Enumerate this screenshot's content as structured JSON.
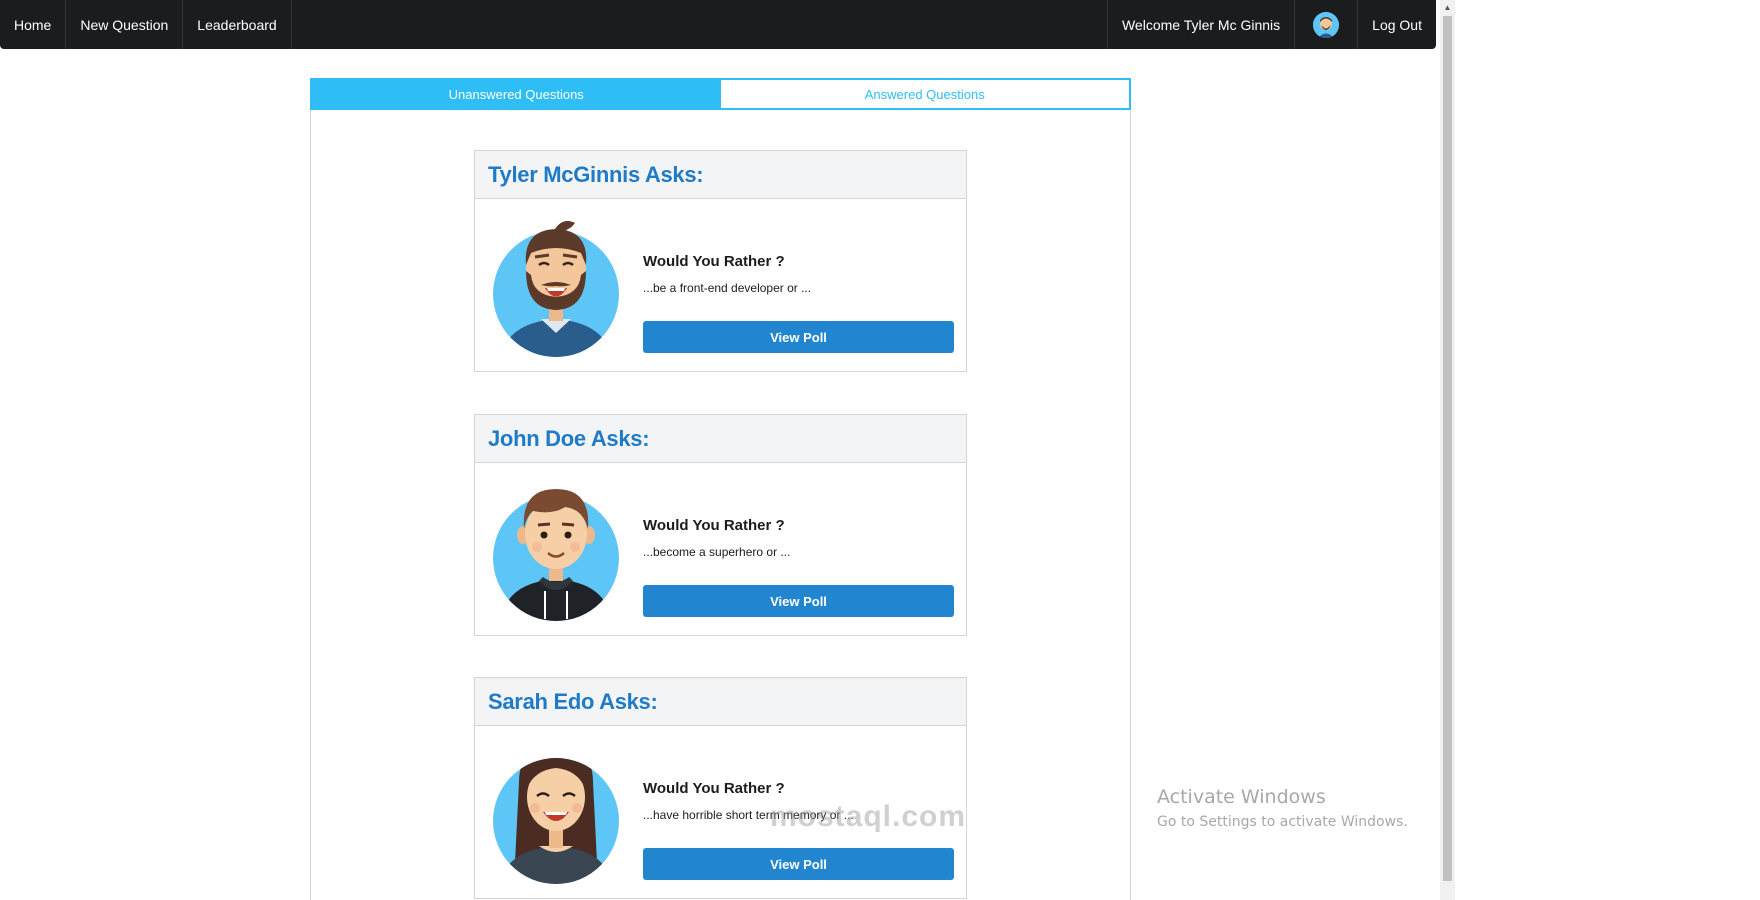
{
  "nav": {
    "home": "Home",
    "new_question": "New Question",
    "leaderboard": "Leaderboard",
    "welcome": "Welcome Tyler Mc Ginnis",
    "logout": "Log Out",
    "avatar_icon": "user-avatar-icon"
  },
  "tabs": {
    "unanswered": "Unanswered Questions",
    "answered": "Answered Questions"
  },
  "questions": [
    {
      "author_title": "Tyler McGinnis Asks:",
      "heading": "Would You Rather ?",
      "snippet": "...be a front-end developer or ...",
      "button": "View Poll",
      "avatar": "bearded-man-avatar"
    },
    {
      "author_title": "John Doe Asks:",
      "heading": "Would You Rather ?",
      "snippet": "...become a superhero or ...",
      "button": "View Poll",
      "avatar": "young-man-hoodie-avatar"
    },
    {
      "author_title": "Sarah Edo Asks:",
      "heading": "Would You Rather ?",
      "snippet": "...have horrible short term memory or ...",
      "button": "View Poll",
      "avatar": "woman-avatar"
    }
  ],
  "watermarks": {
    "activate_title": "Activate Windows",
    "activate_sub": "Go to Settings to activate Windows.",
    "site": "mostaql.com"
  },
  "colors": {
    "nav_bg": "#1b1c1d",
    "tab_accent": "#2fbdf5",
    "title_blue": "#1f7ac8",
    "button_blue": "#2185d0"
  }
}
